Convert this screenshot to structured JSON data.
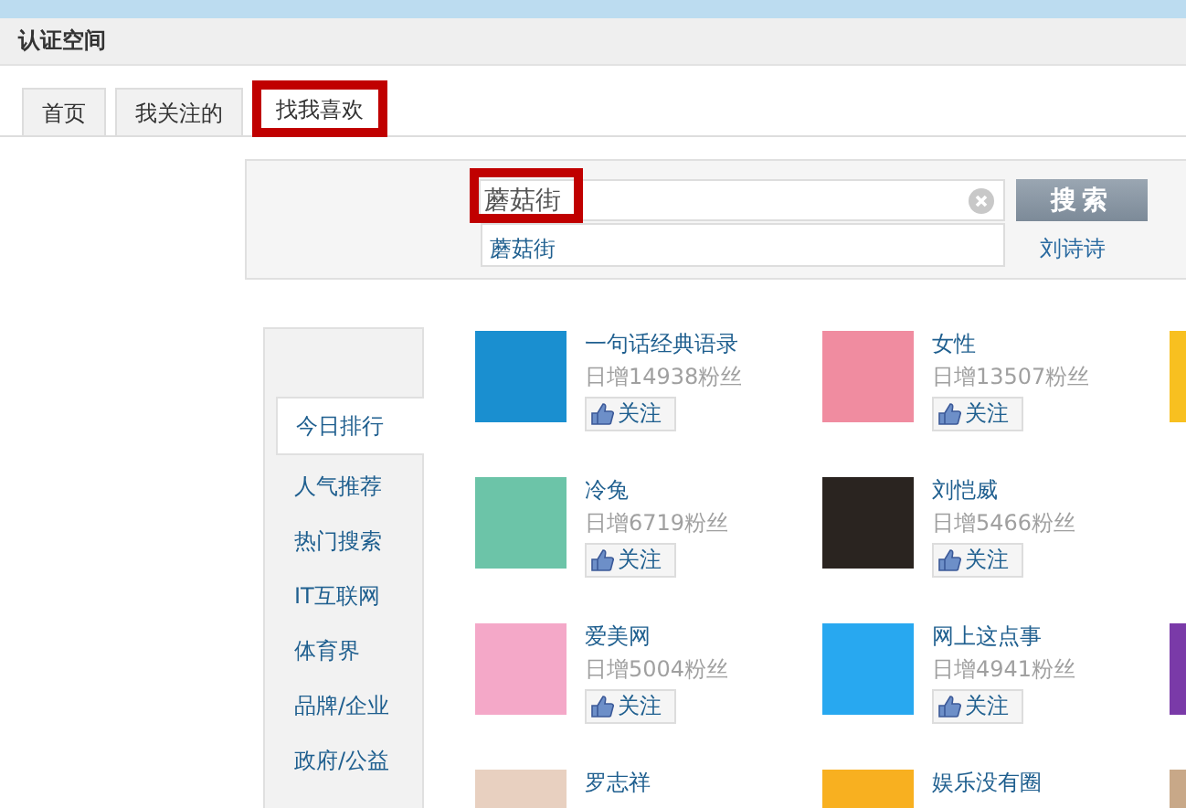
{
  "header": {
    "title": "认证空间"
  },
  "tabs": [
    {
      "label": "首页",
      "selected": false
    },
    {
      "label": "我关注的",
      "selected": false
    },
    {
      "label": "找我喜欢",
      "selected": true
    }
  ],
  "search": {
    "value": "蘑菇街",
    "button": "搜索",
    "suggestions": [
      "蘑菇街"
    ],
    "side_link": "刘诗诗"
  },
  "sidebar": {
    "items": [
      {
        "label": "今日排行",
        "selected": true
      },
      {
        "label": "人气推荐",
        "selected": false
      },
      {
        "label": "热门搜索",
        "selected": false
      },
      {
        "label": "IT互联网",
        "selected": false
      },
      {
        "label": "体育界",
        "selected": false
      },
      {
        "label": "品牌/企业",
        "selected": false
      },
      {
        "label": "政府/公益",
        "selected": false
      }
    ]
  },
  "accounts": [
    {
      "name": "一句话经典语录",
      "stat": "日增14938粉丝",
      "follow": "关注"
    },
    {
      "name": "女性",
      "stat": "日增13507粉丝",
      "follow": "关注"
    },
    {
      "name": "冷兔",
      "stat": "日增6719粉丝",
      "follow": "关注"
    },
    {
      "name": "刘恺威",
      "stat": "日增5466粉丝",
      "follow": "关注"
    },
    {
      "name": "爱美网",
      "stat": "日增5004粉丝",
      "follow": "关注"
    },
    {
      "name": "网上这点事",
      "stat": "日增4941粉丝",
      "follow": "关注"
    },
    {
      "name": "罗志祥"
    },
    {
      "name": "娱乐没有圈"
    }
  ]
}
